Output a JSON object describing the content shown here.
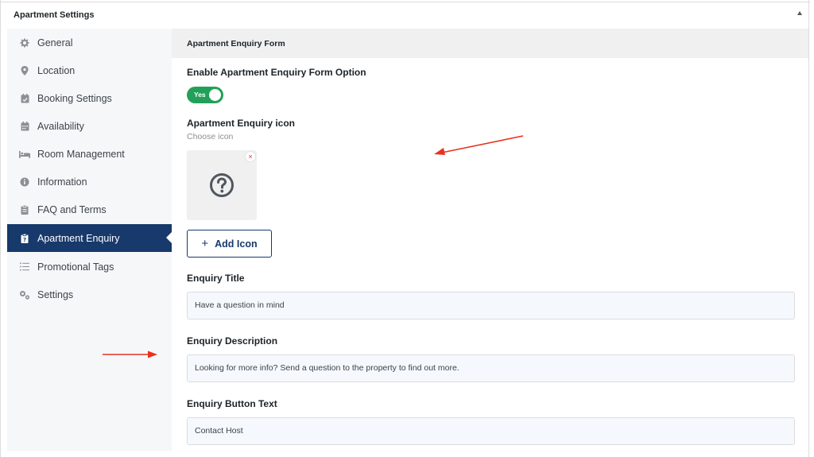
{
  "panel": {
    "title": "Apartment Settings"
  },
  "sidebar": {
    "items": [
      {
        "label": "General",
        "icon": "gear-icon"
      },
      {
        "label": "Location",
        "icon": "map-pin-icon"
      },
      {
        "label": "Booking Settings",
        "icon": "calendar-check-icon"
      },
      {
        "label": "Availability",
        "icon": "calendar-icon"
      },
      {
        "label": "Room Management",
        "icon": "bed-icon"
      },
      {
        "label": "Information",
        "icon": "info-icon"
      },
      {
        "label": "FAQ and Terms",
        "icon": "clipboard-icon"
      },
      {
        "label": "Apartment Enquiry",
        "icon": "question-clipboard-icon",
        "active": true
      },
      {
        "label": "Promotional Tags",
        "icon": "list-icon"
      },
      {
        "label": "Settings",
        "icon": "gears-icon"
      }
    ]
  },
  "main": {
    "section_title": "Apartment Enquiry Form",
    "enable_label": "Enable Apartment Enquiry Form Option",
    "toggle_text": "Yes",
    "icon_label": "Apartment Enquiry icon",
    "icon_sublabel": "Choose icon",
    "remove_label": "×",
    "add_icon_label": "Add Icon",
    "title_label": "Enquiry Title",
    "title_value": "Have a question in mind",
    "description_label": "Enquiry Description",
    "description_value": "Looking for more info? Send a question to the property to find out more.",
    "button_text_label": "Enquiry Button Text",
    "button_text_value": "Contact Host"
  },
  "colors": {
    "accent": "#17396b",
    "toggle_on": "#22a05a",
    "annotation_arrow": "#e8321e"
  }
}
